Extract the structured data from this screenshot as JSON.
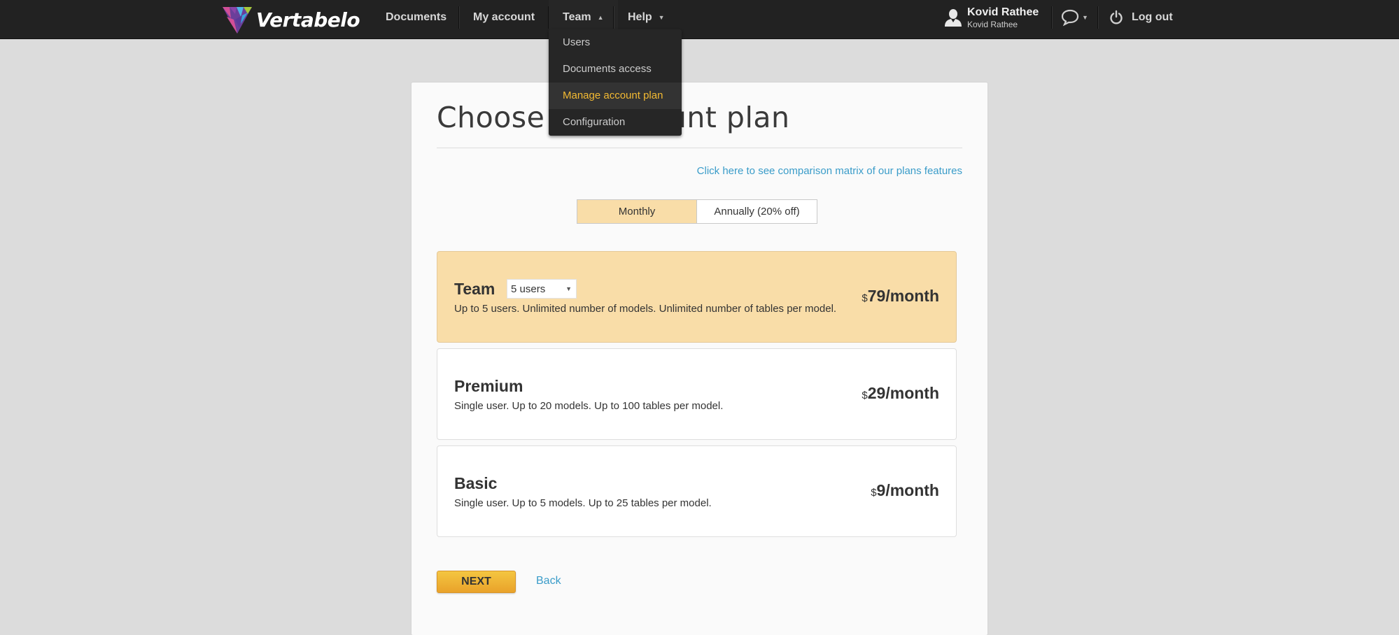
{
  "app": {
    "name": "Vertabelo"
  },
  "nav": {
    "items": [
      {
        "label": "Documents"
      },
      {
        "label": "My account"
      },
      {
        "label": "Team",
        "expanded": true
      },
      {
        "label": "Help"
      }
    ],
    "team_menu": [
      {
        "label": "Users"
      },
      {
        "label": "Documents access"
      },
      {
        "label": "Manage account plan",
        "active": true
      },
      {
        "label": "Configuration"
      }
    ],
    "user": {
      "name": "Kovid Rathee",
      "subtitle": "Kovid Rathee"
    },
    "logout_label": "Log out"
  },
  "page": {
    "title": "Choose an account plan",
    "comparison_link": "Click here to see comparison matrix of our plans features",
    "billing": {
      "options": [
        "Monthly",
        "Annually (20% off)"
      ],
      "selected": "Monthly"
    },
    "plans": [
      {
        "name": "Team",
        "users_select": "5 users",
        "description": "Up to 5 users. Unlimited number of models. Unlimited number of tables per model.",
        "currency": "$",
        "price": "79/month",
        "selected": true
      },
      {
        "name": "Premium",
        "description": "Single user. Up to 20 models. Up to 100 tables per model.",
        "currency": "$",
        "price": "29/month",
        "selected": false
      },
      {
        "name": "Basic",
        "description": "Single user. Up to 5 models. Up to 25 tables per model.",
        "currency": "$",
        "price": "9/month",
        "selected": false
      }
    ],
    "next_label": "NEXT",
    "back_label": "Back"
  },
  "colors": {
    "topbar": "#222222",
    "accent_yellow": "#f2b933",
    "selected_plan": "#f9dda8",
    "link": "#3a9cc9"
  }
}
